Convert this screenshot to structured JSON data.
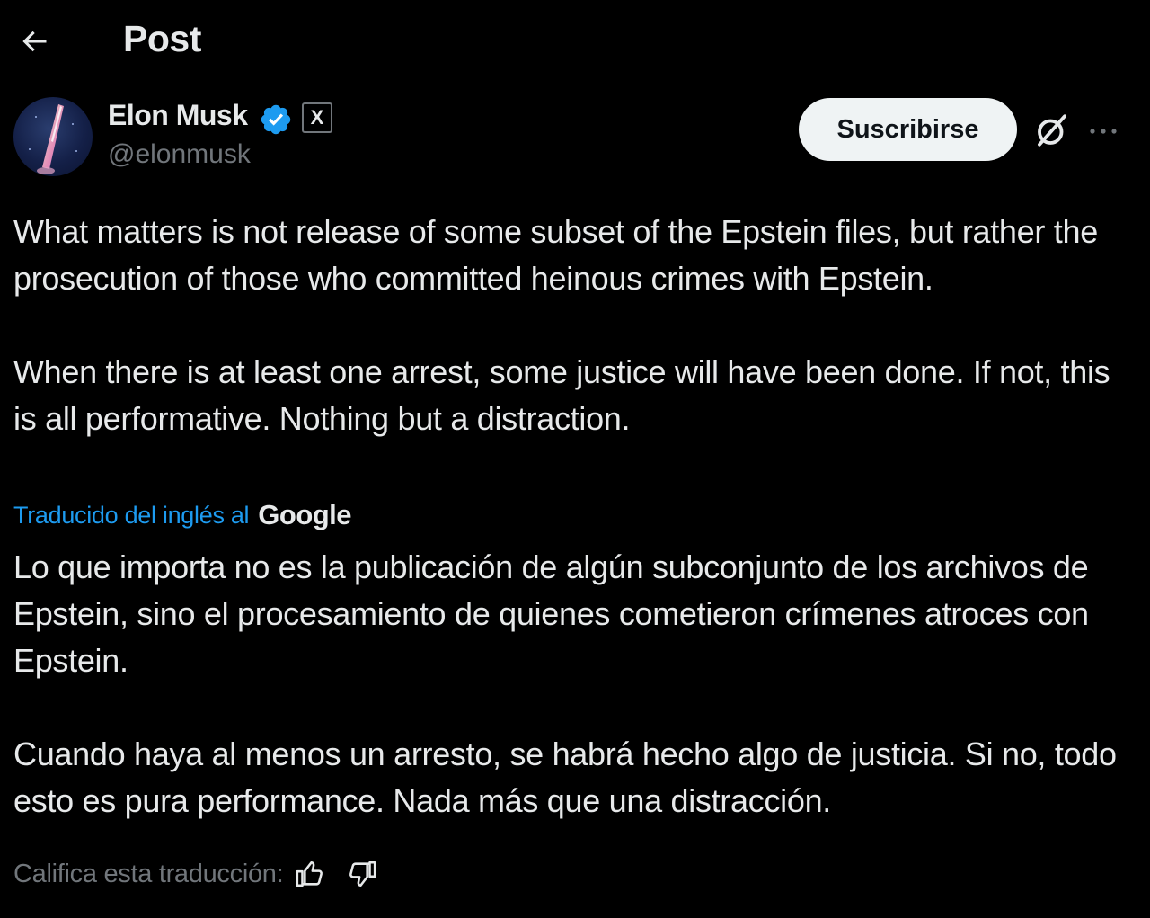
{
  "header": {
    "title": "Post",
    "back_icon": "arrow-left-icon"
  },
  "author": {
    "name": "Elon Musk",
    "handle": "@elonmusk",
    "verified_icon": "verified-badge-icon",
    "affiliate_label": "X",
    "verified_color": "#1d9bf0"
  },
  "actions": {
    "subscribe_label": "Suscribirse",
    "grok_icon": "grok-icon",
    "more_icon": "more-horizontal-icon"
  },
  "post": {
    "original_paragraphs": [
      "What matters is not release of some subset of the Epstein files, but rather the prosecution of those who committed heinous crimes with Epstein.",
      "When there is at least one arrest, some justice will have been done. If not, this is all performative. Nothing but a distraction."
    ],
    "translation": {
      "label": "Traducido del inglés al",
      "provider": "Google",
      "paragraphs": [
        "Lo que importa no es la publicación de algún subconjunto de los archivos de Epstein, sino el procesamiento de quienes cometieron crímenes atroces con Epstein.",
        "Cuando haya al menos un arresto, se habrá hecho algo de justicia. Si no, todo esto es pura performance. Nada más que una distracción."
      ]
    }
  },
  "rating": {
    "label": "Califica esta traducción:",
    "up_icon": "thumbs-up-icon",
    "down_icon": "thumbs-down-icon"
  },
  "colors": {
    "background": "#000000",
    "text": "#e7e9ea",
    "muted": "#71767b",
    "link": "#1d9bf0",
    "button_bg": "#eff3f4"
  }
}
